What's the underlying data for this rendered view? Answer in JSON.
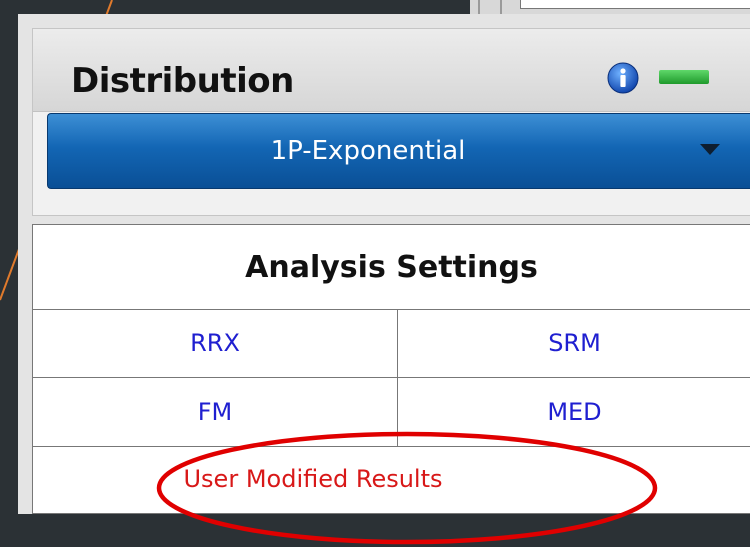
{
  "distribution": {
    "title": "Distribution",
    "selected": "1P-Exponential"
  },
  "analysis_settings": {
    "title": "Analysis Settings",
    "rows": [
      [
        "RRX",
        "SRM"
      ],
      [
        "FM",
        "MED"
      ]
    ],
    "user_modified": "User Modified Results"
  },
  "colors": {
    "dropdown": "#1366b4",
    "link": "#1f1fd0",
    "user_modified": "#d81818",
    "highlight_ellipse": "#e00000",
    "accent_line": "#e07a2c",
    "minimize": "#2fb13c"
  },
  "icons": [
    "info-icon",
    "minimize-icon",
    "chevron-down-icon"
  ]
}
